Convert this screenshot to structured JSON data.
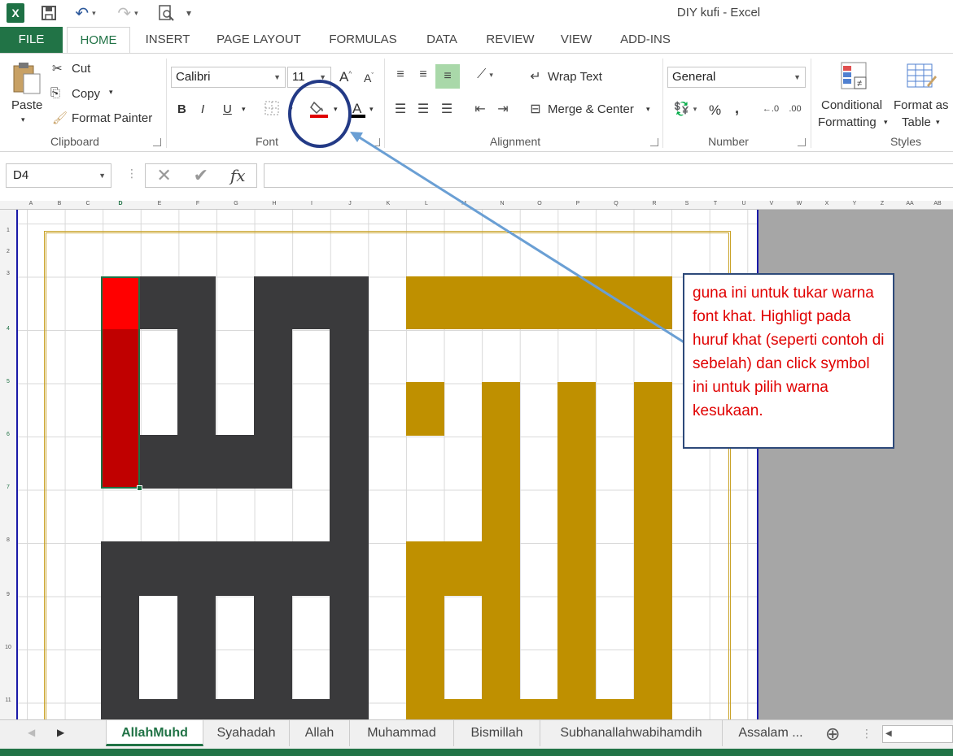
{
  "window": {
    "title": "DIY kufi - Excel"
  },
  "quick_access": {
    "app_icon": "excel-icon",
    "save": "save-icon",
    "undo": "undo-icon",
    "redo": "redo-icon",
    "preview": "print-preview-icon"
  },
  "tabs": [
    "FILE",
    "HOME",
    "INSERT",
    "PAGE LAYOUT",
    "FORMULAS",
    "DATA",
    "REVIEW",
    "VIEW",
    "ADD-INS"
  ],
  "ribbon": {
    "clipboard": {
      "paste": "Paste",
      "cut": "Cut",
      "copy": "Copy",
      "format_painter": "Format Painter",
      "group": "Clipboard"
    },
    "font": {
      "family": "Calibri",
      "size": "11",
      "bold": "B",
      "italic": "I",
      "underline": "U",
      "group": "Font"
    },
    "alignment": {
      "wrap_text": "Wrap Text",
      "merge_center": "Merge & Center",
      "group": "Alignment"
    },
    "number": {
      "format": "General",
      "percent": "%",
      "comma": ",",
      "group": "Number"
    },
    "styles": {
      "conditional_1": "Conditional",
      "conditional_2": "Formatting",
      "format_table_1": "Format as",
      "format_table_2": "Table",
      "group": "Styles"
    }
  },
  "formula_bar": {
    "name_box": "D4",
    "fx": "fx",
    "value": ""
  },
  "columns": [
    "A",
    "B",
    "C",
    "D",
    "E",
    "F",
    "G",
    "H",
    "I",
    "J",
    "K",
    "L",
    "M",
    "N",
    "O",
    "P",
    "Q",
    "R",
    "S",
    "T",
    "U",
    "V",
    "W",
    "X",
    "Y",
    "Z",
    "AA",
    "AB"
  ],
  "rows": [
    "1",
    "2",
    "3",
    "4",
    "5",
    "6",
    "7",
    "8",
    "9",
    "10",
    "11"
  ],
  "callout": {
    "text": "guna ini untuk tukar warna font khat. Highligt pada huruf khat (seperti contoh di sebelah) dan click symbol ini untuk pilih warna kesukaan."
  },
  "sheet_tabs": [
    "AllahMuhd",
    "Syahadah",
    "Allah",
    "Muhammad",
    "Bismillah",
    "Subhanallahwabihamdih",
    "Assalam ..."
  ],
  "colors": {
    "accent": "#217346",
    "dark_block": "#3a3a3c",
    "gold_block": "#bf9000",
    "red_cell": "#c00000",
    "callout_text": "#e00000"
  }
}
